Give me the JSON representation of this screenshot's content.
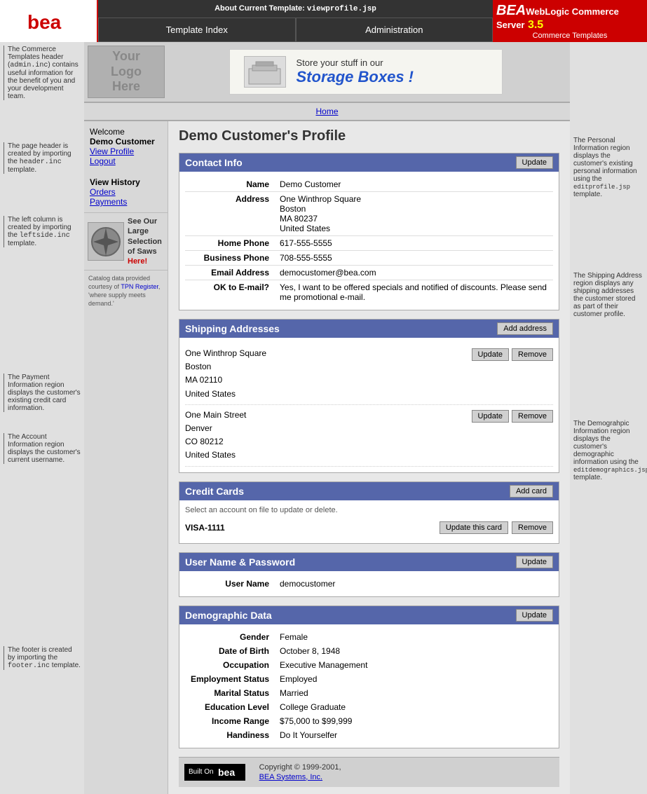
{
  "topbar": {
    "current_template_label": "About Current Template:",
    "current_template_value": "viewprofile.jsp",
    "nav_template_index": "Template Index",
    "nav_administration": "Administration",
    "brand_name": "BEA",
    "brand_product": "WebLogic Commerce Server",
    "brand_version": "3.5",
    "brand_sub": "Commerce Templates"
  },
  "header": {
    "logo_text": "Your\nLogo\nHere",
    "banner_text_top": "Store your stuff in our",
    "banner_text_bottom": "Storage Boxes !"
  },
  "home_nav": {
    "home_label": "Home"
  },
  "sidebar": {
    "welcome_text": "Welcome",
    "customer_name": "Demo Customer",
    "view_profile": "View Profile",
    "logout": "Logout",
    "view_history_title": "View History",
    "orders": "Orders",
    "payments": "Payments",
    "saw_ad_text": "See Our Large Selection of Saws Here!",
    "catalog_text": "Catalog data provided courtesy of TPN Register, 'where supply meets demand.'"
  },
  "profile": {
    "title": "Demo Customer's Profile",
    "contact_info": {
      "section_title": "Contact Info",
      "update_btn": "Update",
      "name_label": "Name",
      "name_value": "Demo Customer",
      "address_label": "Address",
      "address_line1": "One Winthrop Square",
      "address_line2": "Boston",
      "address_line3": "MA  80237",
      "address_line4": "United States",
      "home_phone_label": "Home Phone",
      "home_phone_value": "617-555-5555",
      "business_phone_label": "Business Phone",
      "business_phone_value": "708-555-5555",
      "email_label": "Email Address",
      "email_value": "democustomer@bea.com",
      "ok_email_label": "OK to E-mail?",
      "ok_email_value": "Yes, I want to be offered specials and notified of discounts. Please send me promotional e-mail."
    },
    "shipping": {
      "section_title": "Shipping Addresses",
      "add_address_btn": "Add address",
      "update_btn": "Update",
      "remove_btn": "Remove",
      "addresses": [
        {
          "line1": "One Winthrop Square",
          "line2": "Boston",
          "line3": "MA 02110",
          "line4": "United States"
        },
        {
          "line1": "One Main Street",
          "line2": "Denver",
          "line3": "CO 80212",
          "line4": "United States"
        }
      ]
    },
    "credit_cards": {
      "section_title": "Credit Cards",
      "add_card_btn": "Add card",
      "select_note": "Select an account on file to update or delete.",
      "card_name": "VISA-1111",
      "update_btn": "Update this card",
      "remove_btn": "Remove"
    },
    "username": {
      "section_title": "User Name & Password",
      "update_btn": "Update",
      "user_name_label": "User Name",
      "user_name_value": "democustomer"
    },
    "demographics": {
      "section_title": "Demographic Data",
      "update_btn": "Update",
      "fields": [
        {
          "label": "Gender",
          "value": "Female"
        },
        {
          "label": "Date of Birth",
          "value": "October 8, 1948"
        },
        {
          "label": "Occupation",
          "value": "Executive Management"
        },
        {
          "label": "Employment Status",
          "value": "Employed"
        },
        {
          "label": "Marital Status",
          "value": "Married"
        },
        {
          "label": "Education Level",
          "value": "College Graduate"
        },
        {
          "label": "Income Range",
          "value": "$75,000 to $99,999"
        },
        {
          "label": "Handiness",
          "value": "Do It Yourselfer"
        }
      ]
    }
  },
  "annotations": {
    "left": [
      {
        "text": "The Commerce Templates header (admin.inc) contains useful information for the benefit of you and your development team."
      },
      {
        "text": "The page header is created by importing the header.inc template."
      },
      {
        "text": "The left column is created by importing the leftside.inc template."
      },
      {
        "text": "The Payment Information region displays the customer's existing credit card information."
      },
      {
        "text": "The Account Information region displays the customer's current username."
      },
      {
        "text": "The footer is created by importing the footer.inc template."
      }
    ],
    "right": [
      {
        "text": "The Personal Information region displays the customer's existing personal information using the editprofile.jsp template."
      },
      {
        "text": "The Shipping Address region displays any shipping addresses the customer stored as part of their customer profile."
      },
      {
        "text": "The Demograhpic Information region displays the customer's demographic information using the editdemographics.jsp template."
      }
    ]
  },
  "footer": {
    "built_on_label": "Built On",
    "copyright": "Copyright © 1999-2001,",
    "company_link": "BEA Systems, Inc."
  }
}
